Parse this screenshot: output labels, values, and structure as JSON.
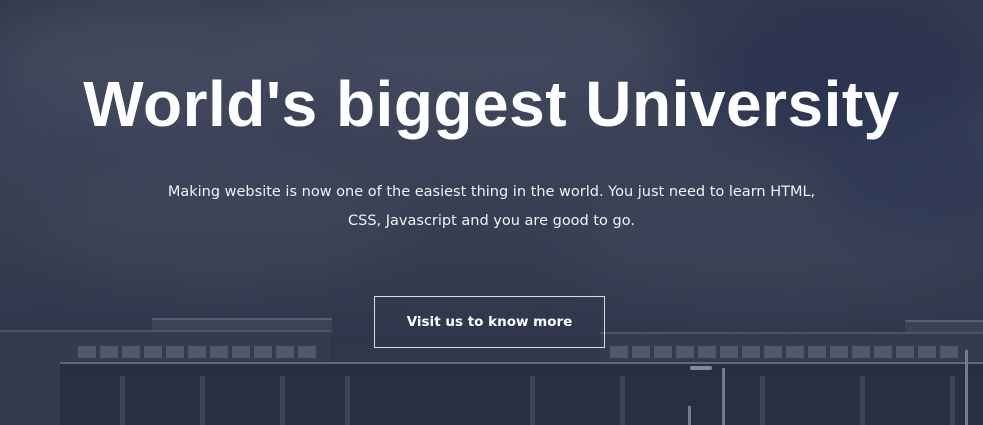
{
  "hero": {
    "title": "World's biggest University",
    "subtitle": "Making website is now one of the easiest thing in the world. You just need to learn HTML, CSS, Javascript and you are good to go.",
    "cta_label": "Visit us to know more"
  },
  "colors": {
    "text": "#ffffff",
    "button_border": "#d8dae2",
    "overlay": "#2a2f44"
  },
  "background": {
    "image": "university-building-under-cloudy-sky"
  }
}
